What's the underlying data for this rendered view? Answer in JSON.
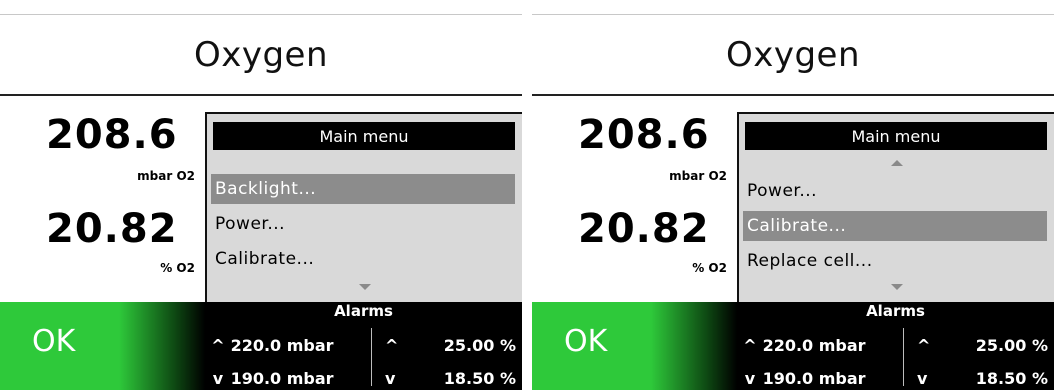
{
  "screens": [
    {
      "title": "Oxygen",
      "readings": [
        {
          "value": "208.6",
          "unit": "mbar O2"
        },
        {
          "value": "20.82",
          "unit": "% O2"
        }
      ],
      "menu": {
        "header": "Main menu",
        "show_up_arrow": false,
        "show_down_arrow": true,
        "items": [
          {
            "label": "Backlight...",
            "selected": true
          },
          {
            "label": "Power...",
            "selected": false
          },
          {
            "label": "Calibrate...",
            "selected": false
          }
        ]
      },
      "status": "OK",
      "alarms": {
        "title": "Alarms",
        "high_pressure": "220.0 mbar",
        "low_pressure": "190.0 mbar",
        "high_percent": "25.00 %",
        "low_percent": "18.50 %"
      }
    },
    {
      "title": "Oxygen",
      "readings": [
        {
          "value": "208.6",
          "unit": "mbar O2"
        },
        {
          "value": "20.82",
          "unit": "% O2"
        }
      ],
      "menu": {
        "header": "Main menu",
        "show_up_arrow": true,
        "show_down_arrow": true,
        "items": [
          {
            "label": "Power...",
            "selected": false
          },
          {
            "label": "Calibrate...",
            "selected": true
          },
          {
            "label": "Replace cell...",
            "selected": false
          }
        ]
      },
      "status": "OK",
      "alarms": {
        "title": "Alarms",
        "high_pressure": "220.0 mbar",
        "low_pressure": "190.0 mbar",
        "high_percent": "25.00 %",
        "low_percent": "18.50 %"
      }
    }
  ],
  "colors": {
    "status_ok": "#2ec93a",
    "menu_background": "#d9d9d9",
    "menu_selected": "#8c8c8c",
    "alarm_panel": "#000000"
  },
  "icons": {
    "up_caret": "caret-up-icon",
    "down_caret": "caret-down-icon"
  }
}
